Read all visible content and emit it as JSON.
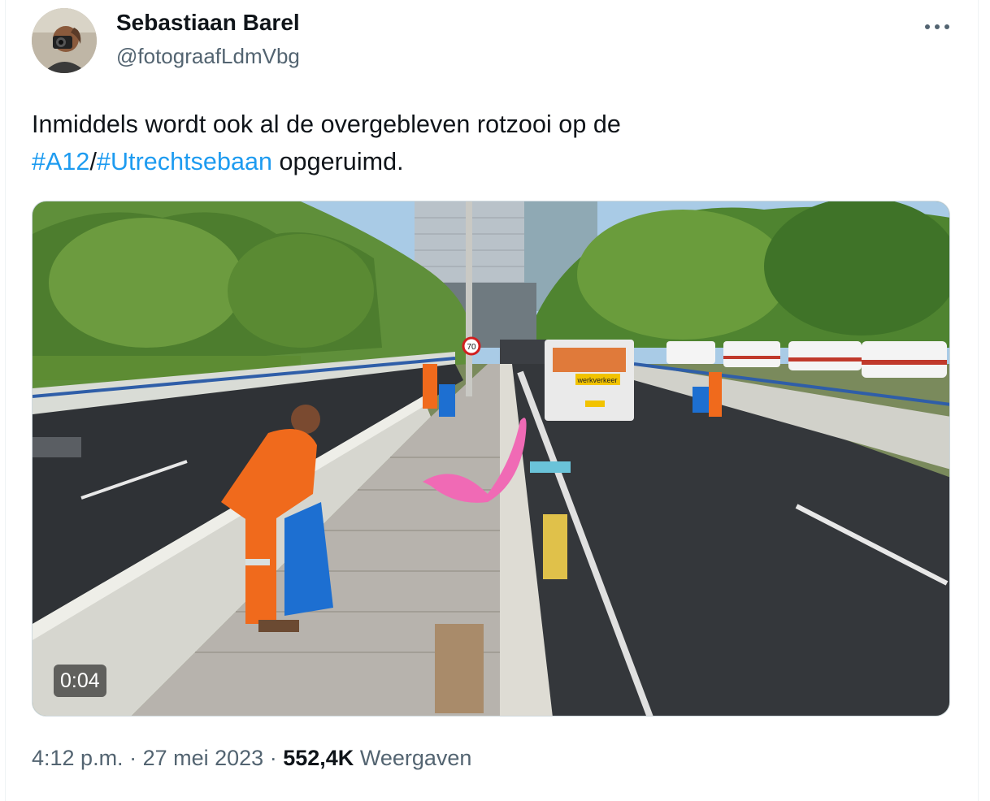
{
  "author": {
    "name": "Sebastiaan Barel",
    "handle": "@fotograafLdmVbg"
  },
  "more_label": "•••",
  "tweet": {
    "line1": "Inmiddels wordt ook al de overgebleven rotzooi op de",
    "hashtag1": "#A12",
    "separator": "/",
    "hashtag2": "#Utrechtsebaan",
    "line2_end": "opgeruimd."
  },
  "media": {
    "duration": "0:04",
    "truck_sign": "werkverkeer",
    "speed_sign": "70"
  },
  "meta": {
    "time": "4:12 p.m.",
    "dot1": "·",
    "date": "27 mei 2023",
    "dot2": "·",
    "views_count": "552,4K",
    "views_label": "Weergaven"
  },
  "colors": {
    "link": "#1d9bf0",
    "secondary_text": "#536471",
    "primary_text": "#0f1419"
  }
}
